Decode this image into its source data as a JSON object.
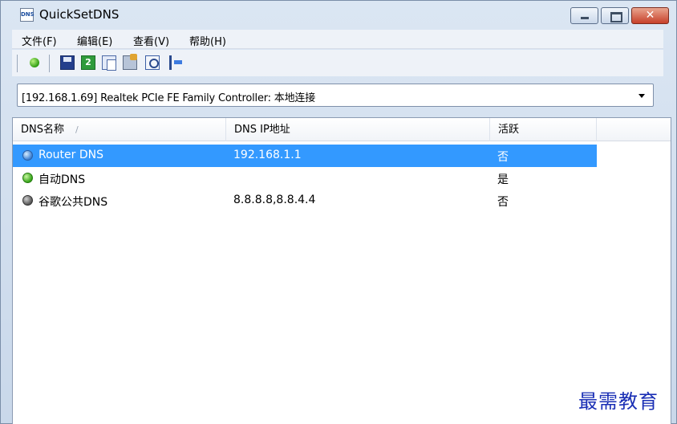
{
  "window": {
    "app_icon_text": "DNS",
    "title": "QuickSetDNS"
  },
  "menu": [
    "文件(F)",
    "编辑(E)",
    "查看(V)",
    "帮助(H)"
  ],
  "toolbar": {
    "icons": [
      "activate-icon",
      "save-icon",
      "refresh-icon",
      "copy-icon",
      "properties-icon",
      "find-icon",
      "exit-icon"
    ]
  },
  "adapter_select": {
    "value": "[192.168.1.69]  Realtek PCIe FE Family Controller: 本地连接"
  },
  "list": {
    "columns": [
      "DNS名称",
      "DNS IP地址",
      "活跃"
    ],
    "sort_indicator": "/",
    "rows": [
      {
        "name": "Router DNS",
        "ip": "192.168.1.1",
        "active": "否",
        "status": "blue",
        "selected": true
      },
      {
        "name": "自动DNS",
        "ip": "",
        "active": "是",
        "status": "green",
        "selected": false
      },
      {
        "name": "谷歌公共DNS",
        "ip": "8.8.8.8,8.8.4.4",
        "active": "否",
        "status": "gray",
        "selected": false
      }
    ]
  },
  "watermark": "最需教育",
  "colors": {
    "selection": "#3399ff",
    "watermark": "#1a2fb5"
  }
}
